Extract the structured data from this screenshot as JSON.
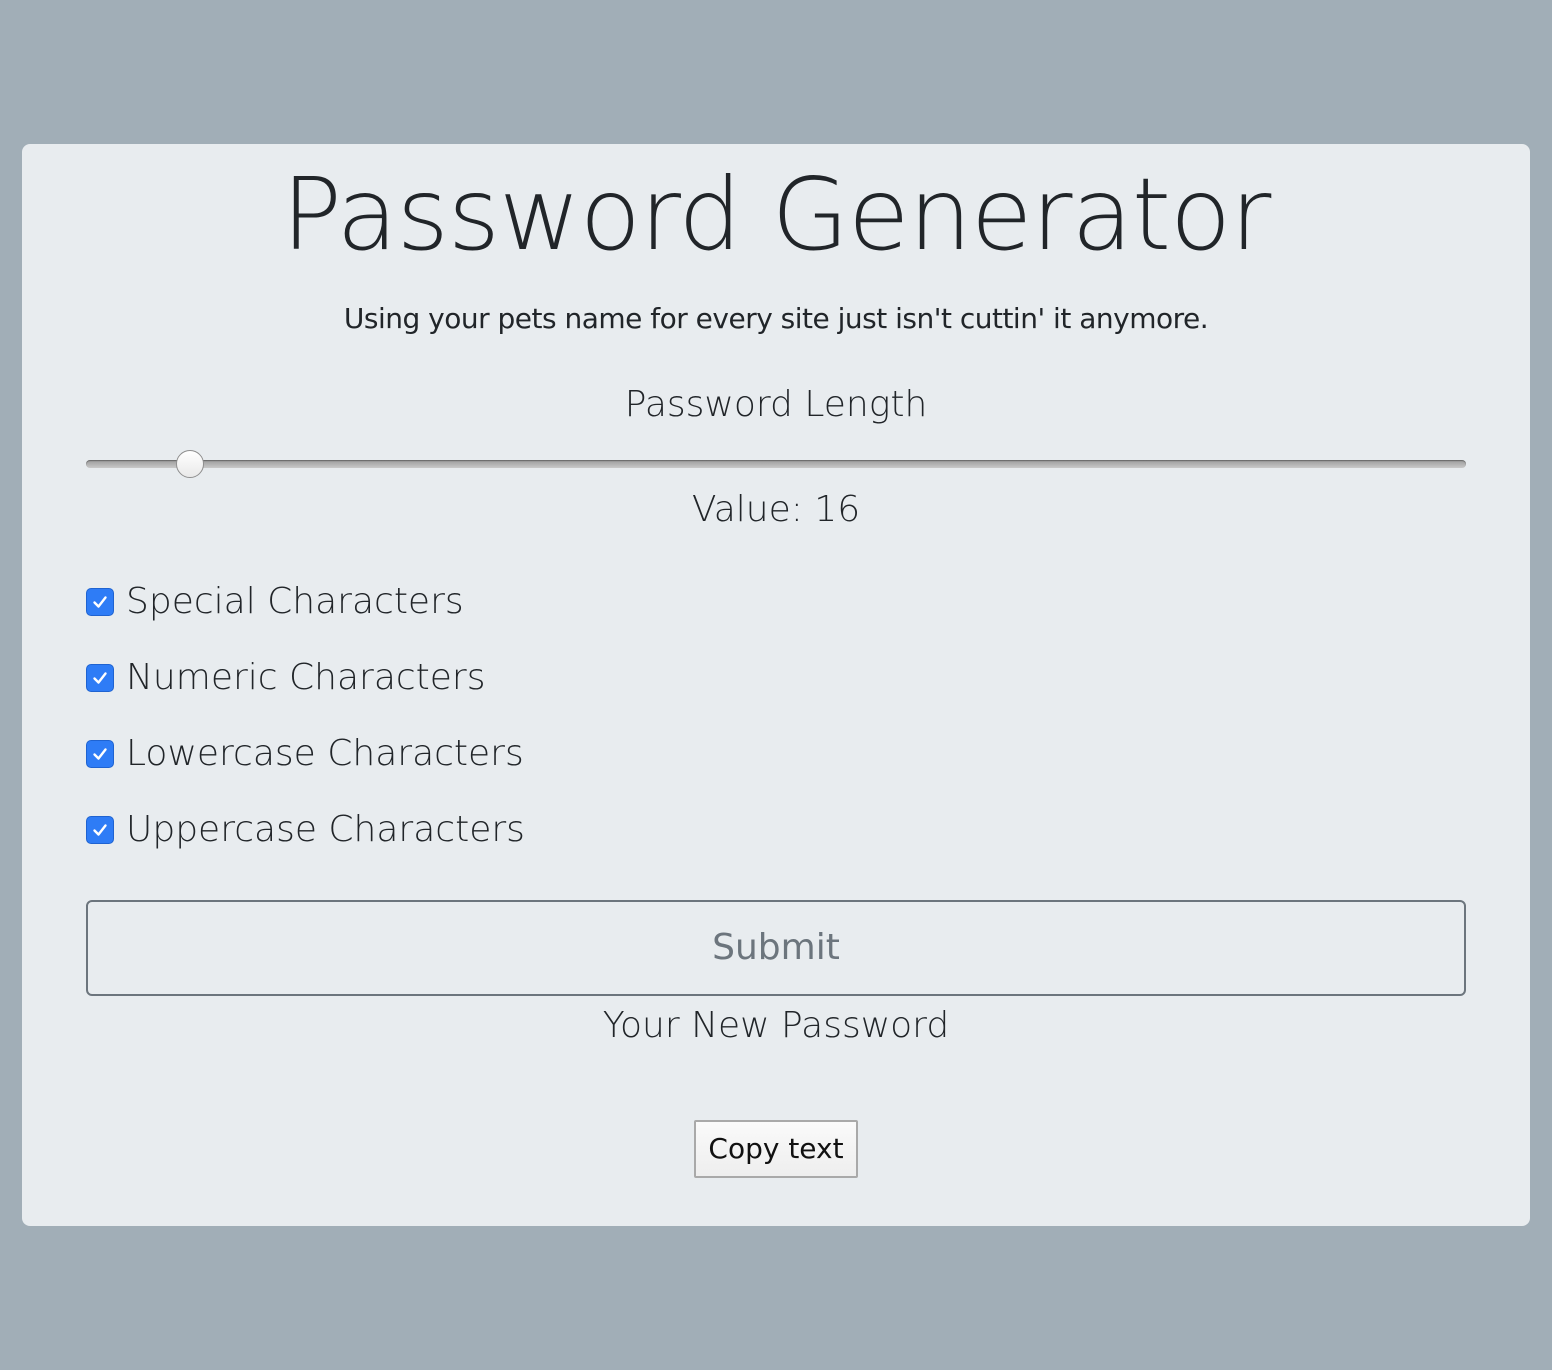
{
  "app": {
    "title": "Password Generator",
    "subtitle": "Using your pets name for every site just isn't cuttin' it anymore."
  },
  "length": {
    "label": "Password Length",
    "value_text": "Value: 16",
    "value": 16,
    "min": 8,
    "max": 128
  },
  "options": [
    {
      "label": "Special Characters",
      "checked": true
    },
    {
      "label": "Numeric Characters",
      "checked": true
    },
    {
      "label": "Lowercase Characters",
      "checked": true
    },
    {
      "label": "Uppercase Characters",
      "checked": true
    }
  ],
  "actions": {
    "submit_label": "Submit",
    "copy_label": "Copy text"
  },
  "output": {
    "label": "Your New Password"
  },
  "colors": {
    "page_background": "#a1aeb7",
    "card_background": "#e8ecef",
    "checkbox_accent": "#2e7cf6",
    "submit_border": "#6c757d"
  }
}
